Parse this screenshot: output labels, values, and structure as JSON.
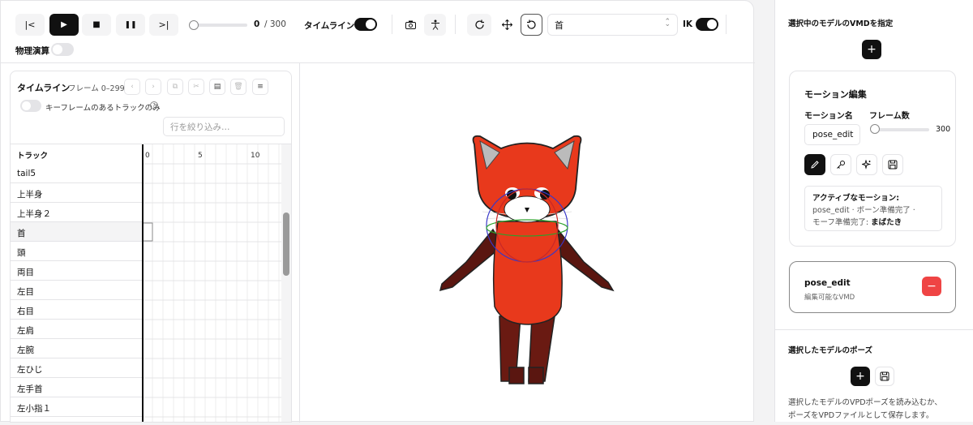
{
  "toolbar": {
    "first_label": "|<",
    "play_label": "▶",
    "stop_label": "■",
    "pause_label": "❚❚",
    "last_label": ">|",
    "frame_current": "0",
    "frame_total": "/ 300",
    "progress": 0,
    "timeline_label": "タイムライン",
    "timeline_on": true,
    "ik_label": "IK",
    "ik_on": true,
    "bone_select": "首",
    "physics_label": "物理演算",
    "physics_on": false
  },
  "timeline": {
    "title": "タイムライン",
    "frame_range": "フレーム 0–299",
    "keyframe_only_label": "キーフレームのあるトラックのみ",
    "filter_placeholder": "行を絞り込み…",
    "track_header": "トラック",
    "ticks": [
      "0",
      "5",
      "10"
    ],
    "tracks": [
      "tail5",
      "上半身",
      "上半身２",
      "首",
      "頭",
      "両目",
      "左目",
      "右目",
      "左肩",
      "左腕",
      "左ひじ",
      "左手首",
      "左小指１"
    ],
    "selected_track": "首"
  },
  "sidebar": {
    "vmd_title": "選択中のモデルのVMDを指定",
    "motion_edit": {
      "title": "モーション編集",
      "name_label": "モーション名",
      "name_value": "pose_edit",
      "frames_label": "フレーム数",
      "frames_value": "300",
      "active_label": "アクティブなモーション:",
      "active_line1": "pose_edit · ボーン準備完了 ·",
      "active_line2_prefix": "モーフ準備完了:",
      "active_line2_bold": "まばたき"
    },
    "vmd_item": {
      "name": "pose_edit",
      "desc": "編集可能なVMD"
    },
    "pose_title": "選択したモデルのポーズ",
    "pose_desc_1": "選択したモデルのVPDポーズを読み込むか、",
    "pose_desc_2": "ポーズをVPDファイルとして保存します。"
  },
  "colors": {
    "accent": "#111111",
    "danger": "#ef4444",
    "fur": "#e8391c",
    "dark_fur": "#5a1610"
  }
}
